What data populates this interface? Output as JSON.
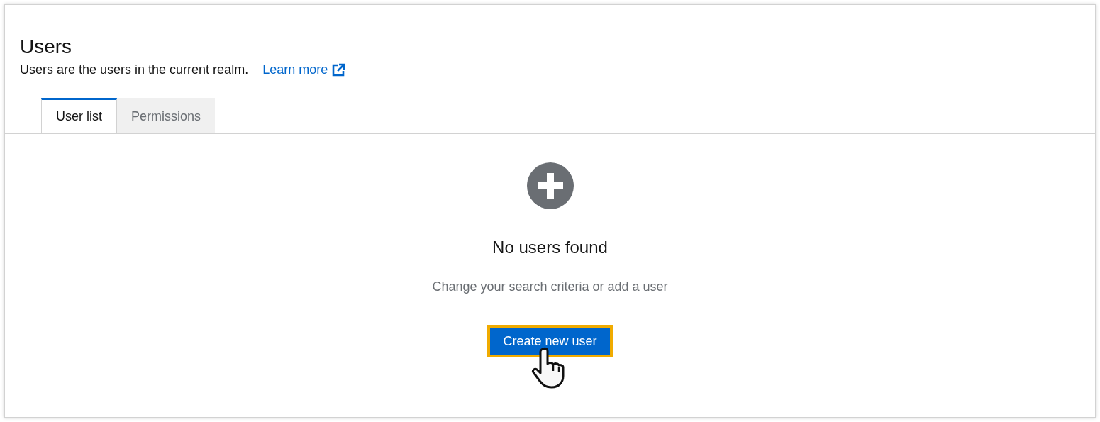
{
  "header": {
    "title": "Users",
    "description": "Users are the users in the current realm.",
    "link": "Learn more"
  },
  "tabs": [
    {
      "label": "User list",
      "selected": true
    },
    {
      "label": "Permissions",
      "selected": false
    }
  ],
  "empty_state": {
    "title": "No users found",
    "message": "Change your search criteria or add a user",
    "button": {
      "label": "Create new user",
      "highlighted": true
    }
  }
}
